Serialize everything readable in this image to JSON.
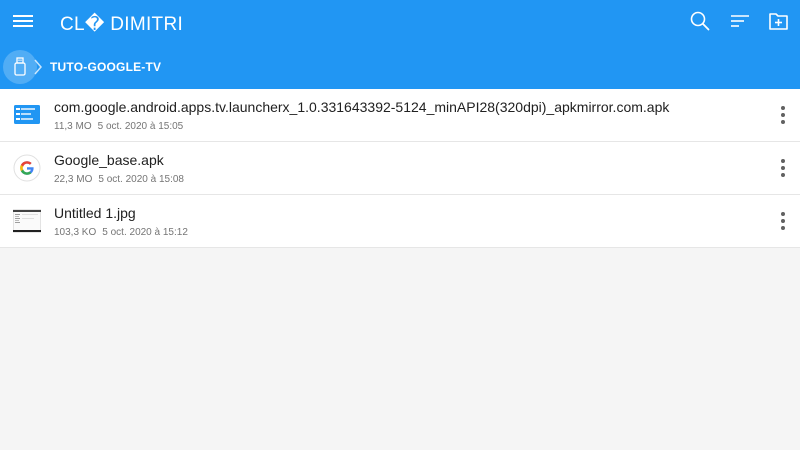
{
  "header": {
    "title": "CL� DIMITRI",
    "background": "#2196f3",
    "icons": [
      "menu-icon",
      "search-icon",
      "sort-icon",
      "new-folder-icon"
    ]
  },
  "breadcrumb": {
    "root_icon": "usb-drive-icon",
    "current": "TUTO-GOOGLE-TV"
  },
  "files": [
    {
      "name": "com.google.android.apps.tv.launcherx_1.0.331643392-5124_minAPI28(320dpi)_apkmirror.com.apk",
      "size": "11,3 MO",
      "date": "5 oct. 2020 à 15:05",
      "icon": "apk-file-icon"
    },
    {
      "name": "Google_base.apk",
      "size": "22,3 MO",
      "date": "5 oct. 2020 à 15:08",
      "icon": "google-logo-icon"
    },
    {
      "name": "Untitled 1.jpg",
      "size": "103,3 KO",
      "date": "5 oct. 2020 à 15:12",
      "icon": "image-thumbnail-icon"
    }
  ]
}
